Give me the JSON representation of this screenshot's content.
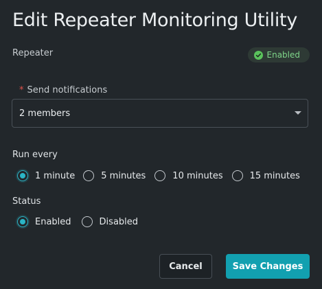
{
  "dialog": {
    "title": "Edit Repeater Monitoring Utility"
  },
  "repeater": {
    "label": "Repeater",
    "status_badge": {
      "text": "Enabled",
      "icon": "check-circle-icon",
      "color": "#5ac25c"
    }
  },
  "notifications": {
    "required_mark": "*",
    "label": "Send notifications",
    "value": "2 members",
    "caret_icon": "caret-down-icon"
  },
  "run_every": {
    "label": "Run every",
    "options": [
      {
        "label": "1 minute",
        "checked": true
      },
      {
        "label": "5 minutes",
        "checked": false
      },
      {
        "label": "10 minutes",
        "checked": false
      },
      {
        "label": "15 minutes",
        "checked": false
      }
    ]
  },
  "status": {
    "label": "Status",
    "options": [
      {
        "label": "Enabled",
        "checked": true
      },
      {
        "label": "Disabled",
        "checked": false
      }
    ]
  },
  "actions": {
    "cancel_label": "Cancel",
    "save_label": "Save Changes"
  },
  "colors": {
    "accent": "#12a0b0",
    "radio_selected": "#2bb5c6",
    "required": "#e0524b",
    "background": "#22272b"
  }
}
